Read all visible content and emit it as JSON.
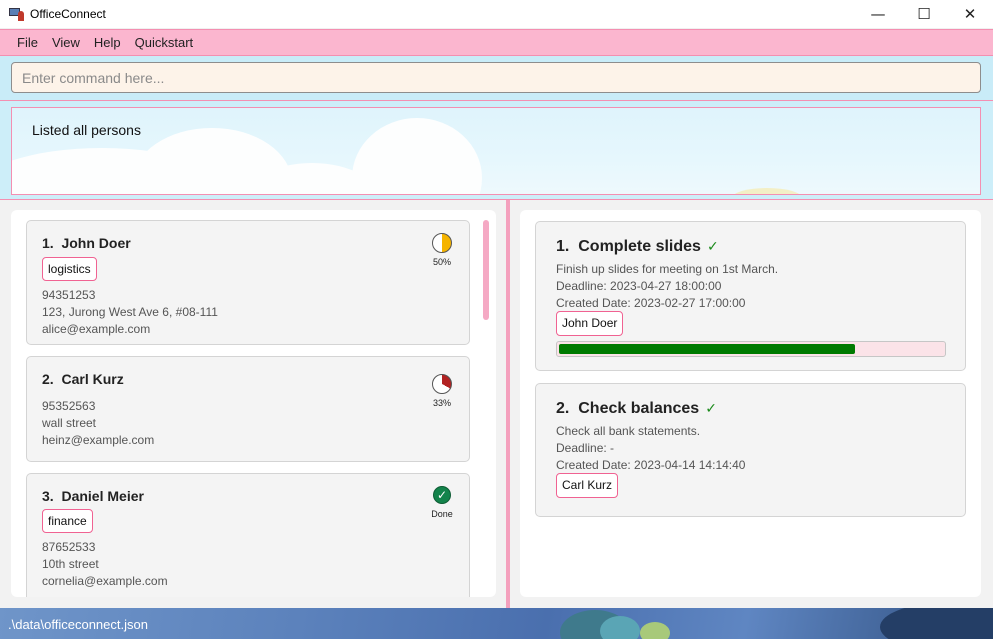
{
  "window": {
    "title": "OfficeConnect",
    "minimize": "—",
    "maximize": "☐",
    "close": "✕"
  },
  "menu": {
    "items": [
      "File",
      "View",
      "Help",
      "Quickstart"
    ]
  },
  "command": {
    "placeholder": "Enter command here...",
    "value": ""
  },
  "result": {
    "message": "Listed all persons"
  },
  "persons": [
    {
      "index": "1.",
      "name": "John Doer",
      "tags": [
        "logistics"
      ],
      "phone": "94351253",
      "address": "123, Jurong West Ave 6, #08-111",
      "email": "alice@example.com",
      "progress": 0.5,
      "progress_label": "50%",
      "progress_color": "#f5b400"
    },
    {
      "index": "2.",
      "name": "Carl Kurz",
      "tags": [],
      "phone": "95352563",
      "address": "wall street",
      "email": "heinz@example.com",
      "progress": 0.33,
      "progress_label": "33%",
      "progress_color": "#b22222"
    },
    {
      "index": "3.",
      "name": "Daniel Meier",
      "tags": [
        "finance"
      ],
      "phone": "87652533",
      "address": "10th street",
      "email": "cornelia@example.com",
      "progress": 1.0,
      "progress_label": "Done",
      "progress_color": "#13834b"
    }
  ],
  "tasks": [
    {
      "index": "1.",
      "title": "Complete slides",
      "done_mark": "✓",
      "description": "Finish up slides for meeting on 1st March.",
      "deadline": "Deadline: 2023-04-27 18:00:00",
      "created": "Created Date: 2023-02-27 17:00:00",
      "assignees": [
        "John Doer"
      ],
      "progress": 0.77
    },
    {
      "index": "2.",
      "title": "Check balances",
      "done_mark": "✓",
      "description": "Check all bank statements.",
      "deadline": "Deadline: -",
      "created": "Created Date: 2023-04-14 14:14:40",
      "assignees": [
        "Carl Kurz"
      ]
    }
  ],
  "status": {
    "path": ".\\data\\officeconnect.json"
  },
  "colors": {
    "menu": "#fbb6cf",
    "accent_pink": "#f06292",
    "progress_green": "#007a00",
    "check_green": "#1a8a1a"
  }
}
